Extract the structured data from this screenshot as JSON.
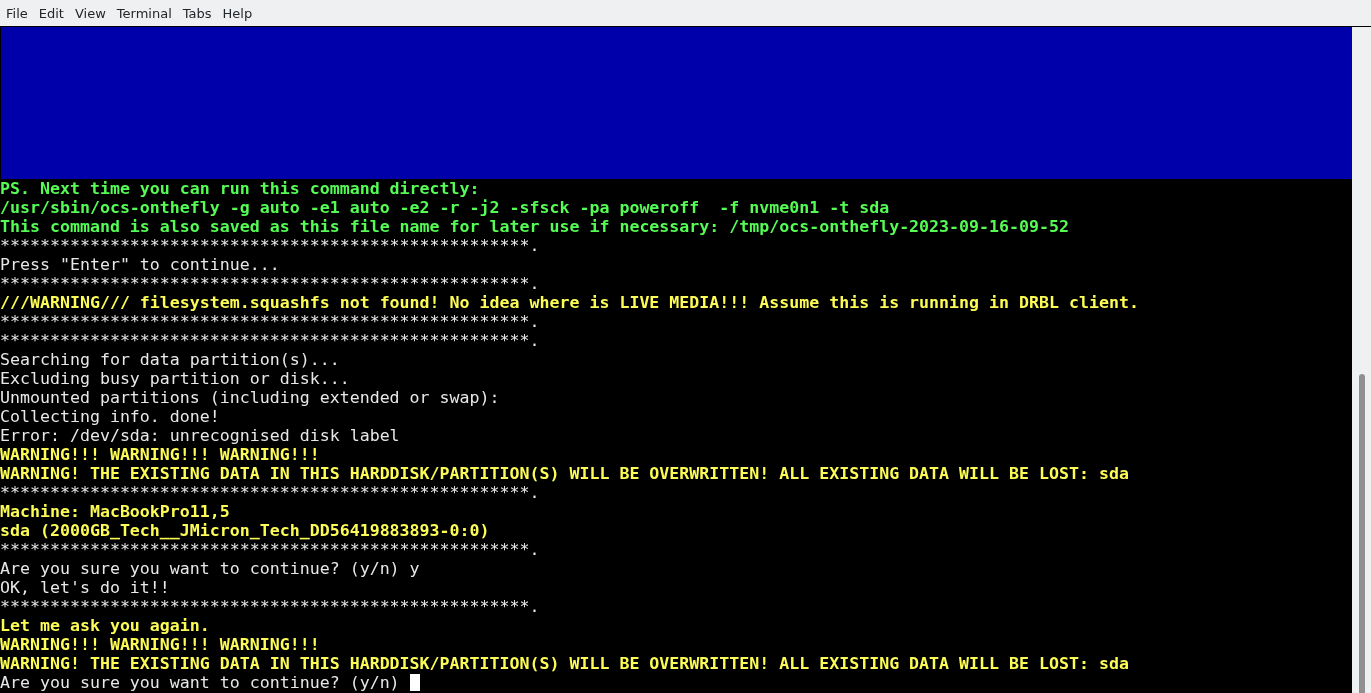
{
  "menu_bar": [
    "File",
    "Edit",
    "View",
    "Terminal",
    "Tabs",
    "Help"
  ],
  "terminal": {
    "lines": [
      {
        "kind": "notice",
        "text": "PS. Next time you can run this command directly:"
      },
      {
        "kind": "notice",
        "text": "/usr/sbin/ocs-onthefly -g auto -e1 auto -e2 -r -j2 -sfsck -pa poweroff  -f nvme0n1 -t sda"
      },
      {
        "kind": "notice",
        "text": "This command is also saved as this file name for later use if necessary: /tmp/ocs-onthefly-2023-09-16-09-52"
      },
      {
        "kind": "plain",
        "text": "*****************************************************."
      },
      {
        "kind": "plain",
        "text": "Press \"Enter\" to continue..."
      },
      {
        "kind": "plain",
        "text": "*****************************************************."
      },
      {
        "kind": "warning",
        "text": "///WARNING/// filesystem.squashfs not found! No idea where is LIVE MEDIA!!! Assume this is running in DRBL client."
      },
      {
        "kind": "plain",
        "text": "*****************************************************."
      },
      {
        "kind": "plain",
        "text": "*****************************************************."
      },
      {
        "kind": "plain",
        "text": "Searching for data partition(s)..."
      },
      {
        "kind": "plain",
        "text": "Excluding busy partition or disk..."
      },
      {
        "kind": "plain",
        "text": "Unmounted partitions (including extended or swap):"
      },
      {
        "kind": "plain",
        "text": "Collecting info. done!"
      },
      {
        "kind": "plain",
        "text": "Error: /dev/sda: unrecognised disk label"
      },
      {
        "kind": "warning",
        "text": "WARNING!!! WARNING!!! WARNING!!!"
      },
      {
        "kind": "warning",
        "text": "WARNING! THE EXISTING DATA IN THIS HARDDISK/PARTITION(S) WILL BE OVERWRITTEN! ALL EXISTING DATA WILL BE LOST: sda"
      },
      {
        "kind": "plain",
        "text": "*****************************************************."
      },
      {
        "kind": "warning",
        "text": "Machine: MacBookPro11,5"
      },
      {
        "kind": "warning",
        "text": "sda (2000GB_Tech__JMicron_Tech_DD56419883893-0:0)"
      },
      {
        "kind": "plain",
        "text": "*****************************************************."
      },
      {
        "kind": "plain",
        "text": "Are you sure you want to continue? (y/n) y"
      },
      {
        "kind": "plain",
        "text": "OK, let's do it!!"
      },
      {
        "kind": "plain",
        "text": "*****************************************************."
      },
      {
        "kind": "warning",
        "text": "Let me ask you again."
      },
      {
        "kind": "warning",
        "text": "WARNING!!! WARNING!!! WARNING!!!"
      },
      {
        "kind": "warning",
        "text": "WARNING! THE EXISTING DATA IN THIS HARDDISK/PARTITION(S) WILL BE OVERWRITTEN! ALL EXISTING DATA WILL BE LOST: sda"
      },
      {
        "kind": "plain",
        "text": "Are you sure you want to continue? (y/n) "
      }
    ]
  }
}
